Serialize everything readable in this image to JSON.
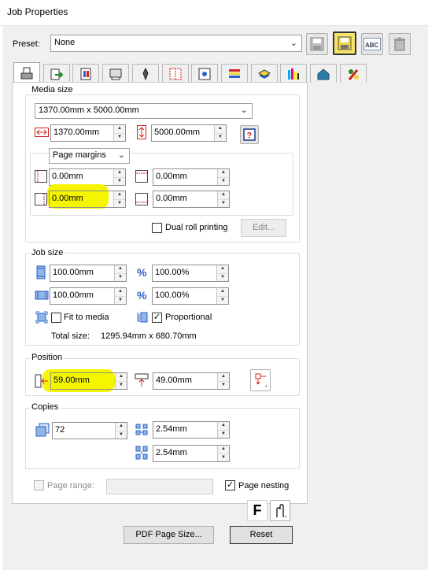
{
  "window": {
    "title": "Job Properties"
  },
  "preset": {
    "label": "Preset:",
    "value": "None"
  },
  "tabs": [
    {
      "icon": "printer-icon"
    },
    {
      "icon": "export-arrow-icon"
    },
    {
      "icon": "color-page-icon"
    },
    {
      "icon": "printer-roll-icon"
    },
    {
      "icon": "pen-tool-icon"
    },
    {
      "icon": "grid-dots-icon"
    },
    {
      "icon": "target-page-icon"
    },
    {
      "icon": "color-bars-icon"
    },
    {
      "icon": "layers-stack-icon"
    },
    {
      "icon": "cmyk-bars-icon"
    },
    {
      "icon": "house-icon"
    },
    {
      "icon": "brush-palette-icon"
    }
  ],
  "media_size": {
    "title": "Media size",
    "size_select": "1370.00mm x 5000.00mm",
    "width": "1370.00mm",
    "height": "5000.00mm",
    "margins_select": "Page margins",
    "margin_left": "0.00mm",
    "margin_top": "0.00mm",
    "margin_right": "0.00mm",
    "margin_bottom": "0.00mm",
    "dual_roll_label": "Dual roll printing",
    "edit_label": "Edit..."
  },
  "job_size": {
    "title": "Job size",
    "height": "100.00mm",
    "height_pct": "100.00%",
    "width": "100.00mm",
    "width_pct": "100.00%",
    "pct_symbol": "%",
    "fit_label": "Fit to media",
    "proportional_label": "Proportional",
    "total_label": "Total size:",
    "total_value": "1295.94mm x 680.70mm"
  },
  "position": {
    "title": "Position",
    "x": "59.00mm",
    "y": "49.00mm"
  },
  "copies": {
    "title": "Copies",
    "count": "72",
    "gap_h": "2.54mm",
    "gap_v": "2.54mm"
  },
  "page_range": {
    "label": "Page range:",
    "value": ""
  },
  "page_nesting": {
    "label": "Page nesting"
  },
  "font_button": {
    "label": "F"
  },
  "footer": {
    "pdf_label": "PDF Page Size...",
    "reset_label": "Reset"
  },
  "colors": {
    "highlight": "#f5f500",
    "accent_red": "#d21f1f",
    "accent_blue": "#2a62c9"
  }
}
